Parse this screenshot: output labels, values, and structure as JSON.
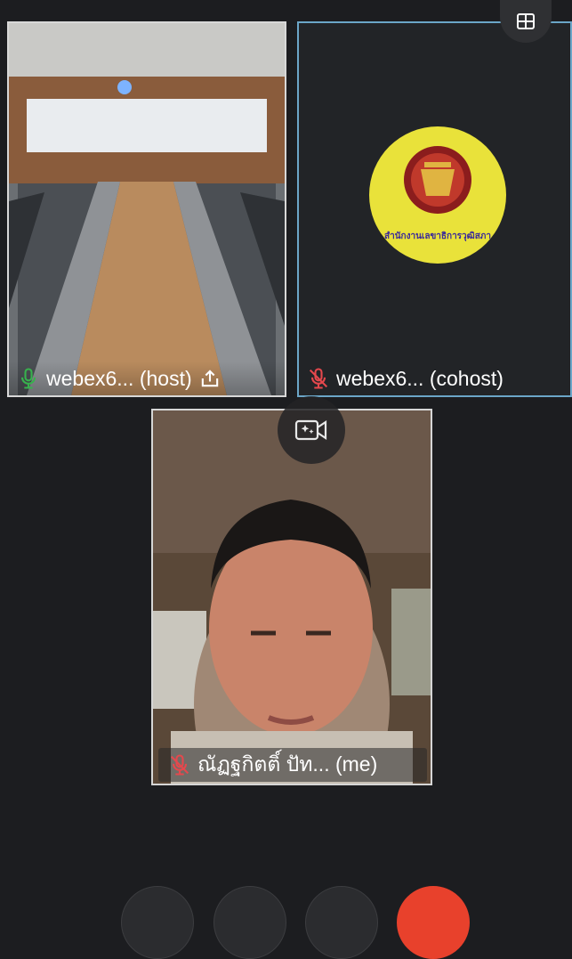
{
  "participants": {
    "host": {
      "name": "webex6... (host)"
    },
    "cohost": {
      "name": "webex6... (cohost)",
      "logo_text": "สำนักงานเลขาธิการวุฒิสภา"
    },
    "me": {
      "name": "ณัฏฐกิตติ์ ปัท... (me)"
    }
  },
  "icons": {
    "layout": "grid-layout-icon",
    "camera_switch": "camera-switch-icon",
    "mic_on": "mic-icon",
    "mic_muted": "mic-muted-icon",
    "share": "share-icon"
  },
  "colors": {
    "background": "#1c1d20",
    "mic_active": "#37b24d",
    "mic_muted": "#e5484d",
    "cohost_border": "#6ba6c8",
    "end_button": "#e8412c"
  }
}
